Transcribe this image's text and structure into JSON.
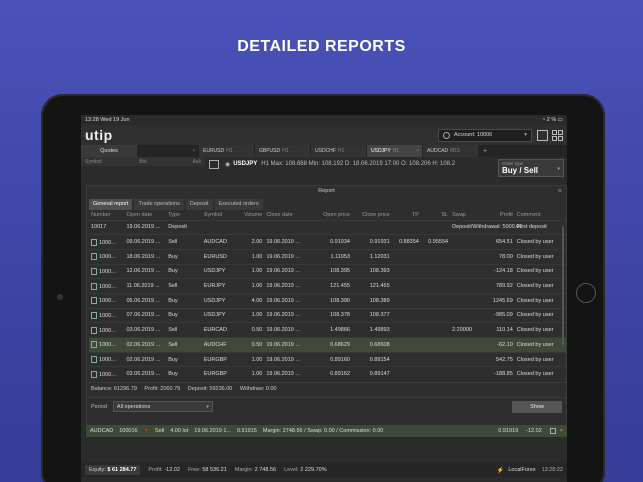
{
  "headline": "DETAILED REPORTS",
  "status": {
    "time": "13:28",
    "date": "Wed 19 Jun",
    "battery": "2 %"
  },
  "app": {
    "logo": "utip",
    "account_label": "Account: 10006"
  },
  "quotes": {
    "tab": "Quotes",
    "col_symbol": "Symbol",
    "col_bid": "Bid",
    "col_ask": "Ask"
  },
  "instrument_tabs": [
    {
      "symbol": "EURUSD",
      "tf": "H1"
    },
    {
      "symbol": "GBPUSD",
      "tf": "H1"
    },
    {
      "symbol": "USDCHF",
      "tf": "H1"
    },
    {
      "symbol": "USDJPY",
      "tf": "H1"
    },
    {
      "symbol": "AUDCAD",
      "tf": "M15"
    }
  ],
  "chart_info": {
    "symbol": "USDJPY",
    "text": "H1  Max: 108.688  Min: 108.192  D: 18.06.2019 17:00  O: 108.206  H: 108.2"
  },
  "order_type": {
    "label": "Order type",
    "value": "Buy / Sell"
  },
  "report": {
    "title": "Report",
    "tabs": [
      "General report",
      "Trade operations",
      "Deposit",
      "Executed orders"
    ],
    "columns": [
      "Number",
      "Open date",
      "Type",
      "Symbol",
      "Volume",
      "Close date",
      "Open price",
      "Close price",
      "TP",
      "SL",
      "Swap",
      "Profit",
      "Comment"
    ],
    "rows": [
      [
        "10017",
        "19.06.2019 ...",
        "Deposit",
        "",
        "",
        "",
        "",
        "",
        "",
        "",
        "Deposit/Withdrawal: 5000.00",
        "",
        "First deposit"
      ],
      [
        "1000...",
        "09.06.2019 ...",
        "Sell",
        "AUDCAD",
        "2.00",
        "19.06.2019 ...",
        "0.91934",
        "0.91931",
        "0.88354",
        "0.95554",
        "",
        "654.51",
        "Closed by user"
      ],
      [
        "1000...",
        "18.06.2019 ...",
        "Buy",
        "EURUSD",
        "1.00",
        "19.06.2019 ...",
        "1.11953",
        "1.12031",
        "",
        "",
        "",
        "78.00",
        "Closed by user"
      ],
      [
        "1000...",
        "12.06.2019 ...",
        "Buy",
        "USDJPY",
        "1.00",
        "19.06.2019 ...",
        "108.395",
        "108.393",
        "",
        "",
        "",
        "-124.18",
        "Closed by user"
      ],
      [
        "1000...",
        "11.06.2019 ...",
        "Sell",
        "EURJPY",
        "1.00",
        "19.06.2019 ...",
        "121.455",
        "121.465",
        "",
        "",
        "",
        "789.92",
        "Closed by user"
      ],
      [
        "1000...",
        "05.06.2019 ...",
        "Buy",
        "USDJPY",
        "4.00",
        "19.06.2019 ...",
        "108.390",
        "108.389",
        "",
        "",
        "",
        "1245.69",
        "Closed by user"
      ],
      [
        "1000...",
        "07.06.2019 ...",
        "Buy",
        "USDJPY",
        "1.00",
        "19.06.2019 ...",
        "108.378",
        "108.377",
        "",
        "",
        "",
        "-985.09",
        "Closed by user"
      ],
      [
        "1000...",
        "03.06.2019 ...",
        "Sell",
        "EURCAD",
        "0.50",
        "19.06.2019 ...",
        "1.49866",
        "1.49893",
        "",
        "",
        "2.20000",
        "110.14",
        "Closed by user"
      ],
      [
        "1000...",
        "02.06.2019 ...",
        "Sell",
        "AUDCHF",
        "0.50",
        "19.06.2019 ...",
        "0.68629",
        "0.68608",
        "",
        "",
        "",
        "-62.10",
        "Closed by user"
      ],
      [
        "1000...",
        "02.06.2019 ...",
        "Buy",
        "EURGBP",
        "1.00",
        "19.06.2019 ...",
        "0.89160",
        "0.89154",
        "",
        "",
        "",
        "542.75",
        "Closed by user"
      ],
      [
        "1000...",
        "03.06.2019 ...",
        "Buy",
        "EURGBP",
        "1.00",
        "19.06.2019 ...",
        "0.89162",
        "0.89147",
        "",
        "",
        "",
        "-188.85",
        "Closed by user"
      ]
    ],
    "highlight_row": 8,
    "balance": {
      "balance": "Balance: 61296.79",
      "profit": "Profit: 2060.79",
      "deposit": "Deposit: 59236.00",
      "withdraw": "Withdraw: 0.00"
    },
    "period_label": "Period",
    "period_value": "All operations",
    "show_button": "Show"
  },
  "position": {
    "symbol": "AUDCAD",
    "number": "100016",
    "type": "Sell",
    "volume": "4.00 lot",
    "open_date": "19.06.2019 1...",
    "open_price": "0.91915",
    "details": "Margin: 2748.56 / Swap: 0.00 / Commission: 0.00",
    "current": "0.91919",
    "profit": "-12.02"
  },
  "footer": {
    "equity_label": "Equity:",
    "equity": "$ 61 284.77",
    "profit_label": "Profit:",
    "profit": "-12.02",
    "free_label": "Free:",
    "free": "58 536.21",
    "margin_label": "Margin:",
    "margin": "2 748.56",
    "level_label": "Level:",
    "level": "2 229.70%",
    "server": "LocalForex",
    "time": "13:28:22"
  }
}
